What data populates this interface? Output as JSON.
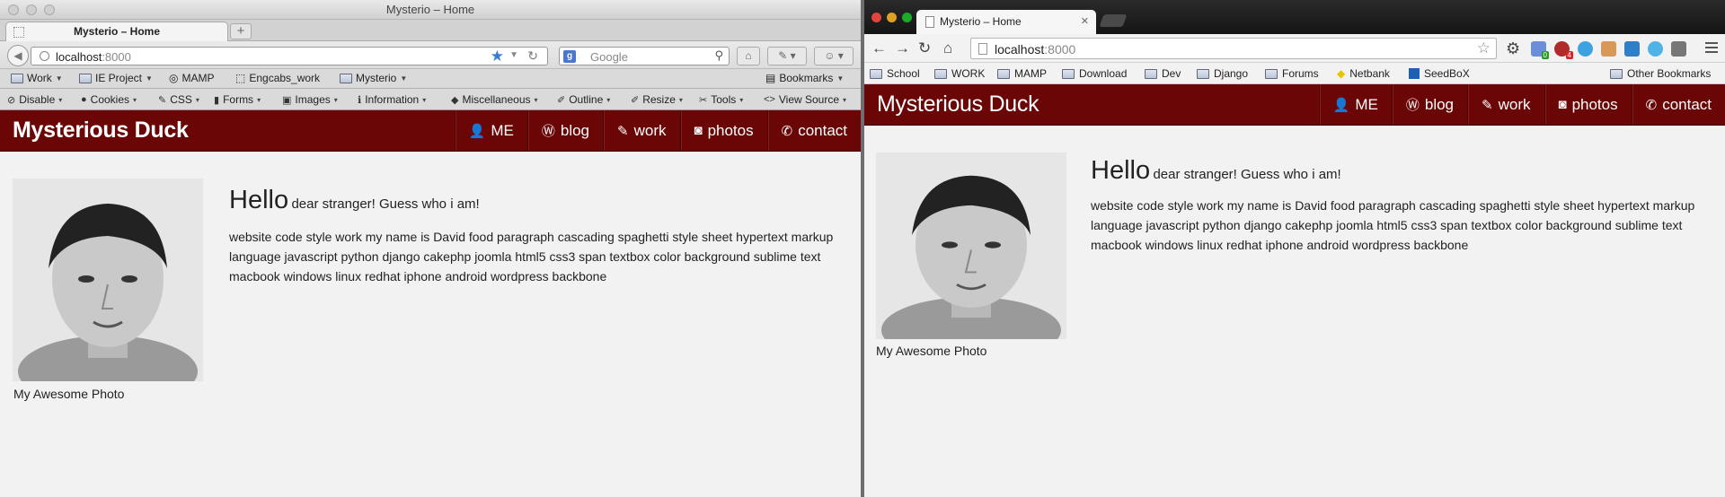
{
  "firefox": {
    "window_title": "Mysterio – Home",
    "tab_title": "Mysterio – Home",
    "new_tab": "+",
    "url_host": "localhost",
    "url_port": ":8000",
    "search_placeholder": "Google",
    "bookmarks": [
      {
        "label": "Work"
      },
      {
        "label": "IE Project"
      },
      {
        "label": "MAMP"
      },
      {
        "label": "Engcabs_work"
      },
      {
        "label": "Mysterio"
      }
    ],
    "bookmarks_menu": "Bookmarks",
    "devtools": [
      {
        "label": "Disable"
      },
      {
        "label": "Cookies"
      },
      {
        "label": "CSS"
      },
      {
        "label": "Forms"
      },
      {
        "label": "Images"
      },
      {
        "label": "Information"
      },
      {
        "label": "Miscellaneous"
      },
      {
        "label": "Outline"
      },
      {
        "label": "Resize"
      },
      {
        "label": "Tools"
      },
      {
        "label": "View Source"
      }
    ]
  },
  "chrome": {
    "tab_title": "Mysterio – Home",
    "url_host": "localhost",
    "url_port": ":8000",
    "ext_badges": [
      "0",
      "4"
    ],
    "bookmarks": [
      {
        "label": "School"
      },
      {
        "label": "WORK"
      },
      {
        "label": "MAMP"
      },
      {
        "label": "Download"
      },
      {
        "label": "Dev"
      },
      {
        "label": "Django"
      },
      {
        "label": "Forums"
      },
      {
        "label": "Netbank"
      },
      {
        "label": "SeedBoX"
      }
    ],
    "other_bookmarks": "Other Bookmarks"
  },
  "site": {
    "brand": "Mysterious Duck",
    "nav": [
      {
        "label": "ME",
        "icon": "user-icon"
      },
      {
        "label": "blog",
        "icon": "wordpress-icon"
      },
      {
        "label": "work",
        "icon": "edit-icon"
      },
      {
        "label": "photos",
        "icon": "instagram-icon"
      },
      {
        "label": "contact",
        "icon": "phone-icon"
      }
    ],
    "hello": "Hello",
    "subtitle": "dear stranger! Guess who i am!",
    "paragraph": "website code style work my name is David food paragraph cascading spaghetti style sheet hypertext markup language javascript python django cakephp joomla html5 css3 span textbox color background sublime text macbook windows linux redhat iphone android wordpress backbone",
    "photo_caption": "My Awesome Photo",
    "colors": {
      "navbar": "#6b0607",
      "page_bg": "#f2f2f2",
      "text": "#222222"
    }
  }
}
